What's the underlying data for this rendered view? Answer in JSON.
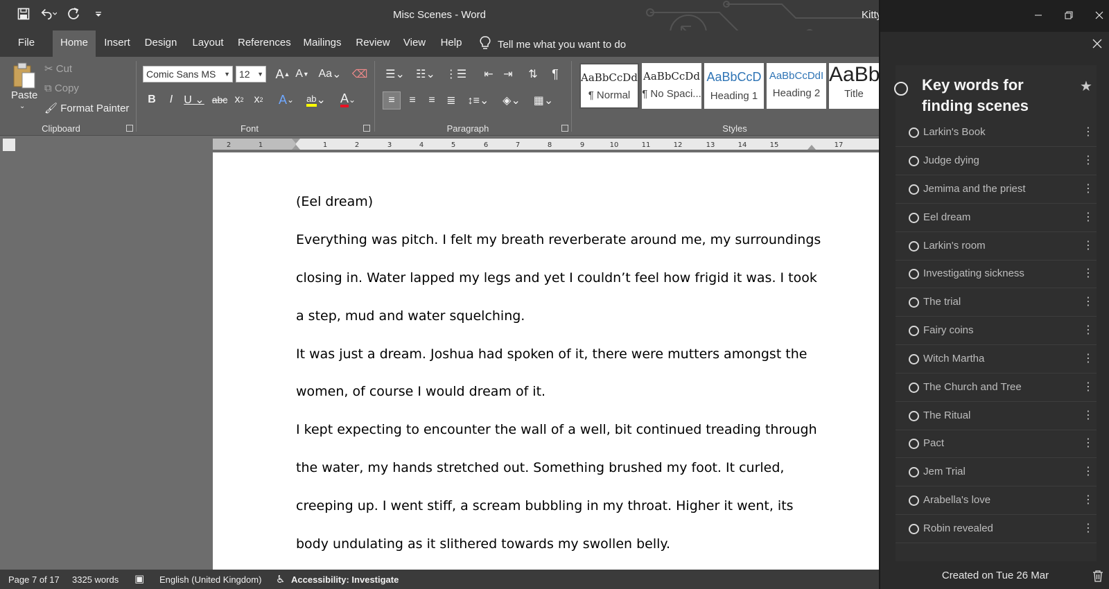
{
  "word": {
    "title": "Misc Scenes  -  Word",
    "user": "Kitty",
    "qat": {
      "save": "save-icon",
      "undo": "undo-icon",
      "redo": "redo-icon",
      "customize": "customize-icon"
    },
    "tabs": [
      "File",
      "Home",
      "Insert",
      "Design",
      "Layout",
      "References",
      "Mailings",
      "Review",
      "View",
      "Help"
    ],
    "active_tab": "Home",
    "tell_me": "Tell me what you want to do",
    "ribbon": {
      "clipboard": {
        "paste": "Paste",
        "cut": "Cut",
        "copy": "Copy",
        "format_painter": "Format Painter",
        "group": "Clipboard"
      },
      "font": {
        "name": "Comic Sans MS",
        "size": "12",
        "case": "Aa",
        "group": "Font"
      },
      "paragraph": {
        "group": "Paragraph"
      },
      "styles": {
        "group": "Styles",
        "items": [
          {
            "sample": "AaBbCcDd",
            "name": "¶ Normal"
          },
          {
            "sample": "AaBbCcDd",
            "name": "¶ No Spaci..."
          },
          {
            "sample": "AaBbCcD",
            "name": "Heading 1"
          },
          {
            "sample": "AaBbCcDdI",
            "name": "Heading 2"
          },
          {
            "sample": "AaBb",
            "name": "Title"
          }
        ]
      }
    },
    "ruler": [
      "2",
      "1",
      "1",
      "2",
      "3",
      "4",
      "5",
      "6",
      "7",
      "8",
      "9",
      "10",
      "11",
      "12",
      "13",
      "14",
      "15",
      "17"
    ],
    "document_lines": [
      "(Eel dream)",
      "Everything was pitch. I felt my breath reverberate around me, my surroundings",
      "closing in. Water lapped my legs and yet I couldn’t feel how frigid it was. I took",
      "a step, mud and water squelching.",
      "It was just a dream. Joshua had spoken of it, there were mutters amongst the",
      "women, of course I would dream of it.",
      "I kept expecting to encounter the wall of a well, bit continued treading through",
      "the water, my hands stretched out. Something brushed my foot. It curled,",
      "creeping up. I went stiff, a scream bubbling in my throat. Higher it went, its",
      "body undulating as it slithered towards my swollen belly."
    ],
    "status": {
      "page": "Page 7 of 17",
      "words": "3325 words",
      "language": "English (United Kingdom)",
      "accessibility": "Accessibility: Investigate"
    }
  },
  "todo": {
    "title": "Key words for finding scenes",
    "steps": [
      "Larkin's Book",
      "Judge dying",
      "Jemima and the priest",
      "Eel dream",
      "Larkin's room",
      "Investigating sickness",
      "The trial",
      "Fairy coins",
      "Witch Martha",
      "The Church and Tree",
      "The Ritual",
      "Pact",
      "Jem Trial",
      "Arabella's love",
      "Robin revealed"
    ],
    "footer": "Created on Tue 26 Mar"
  }
}
